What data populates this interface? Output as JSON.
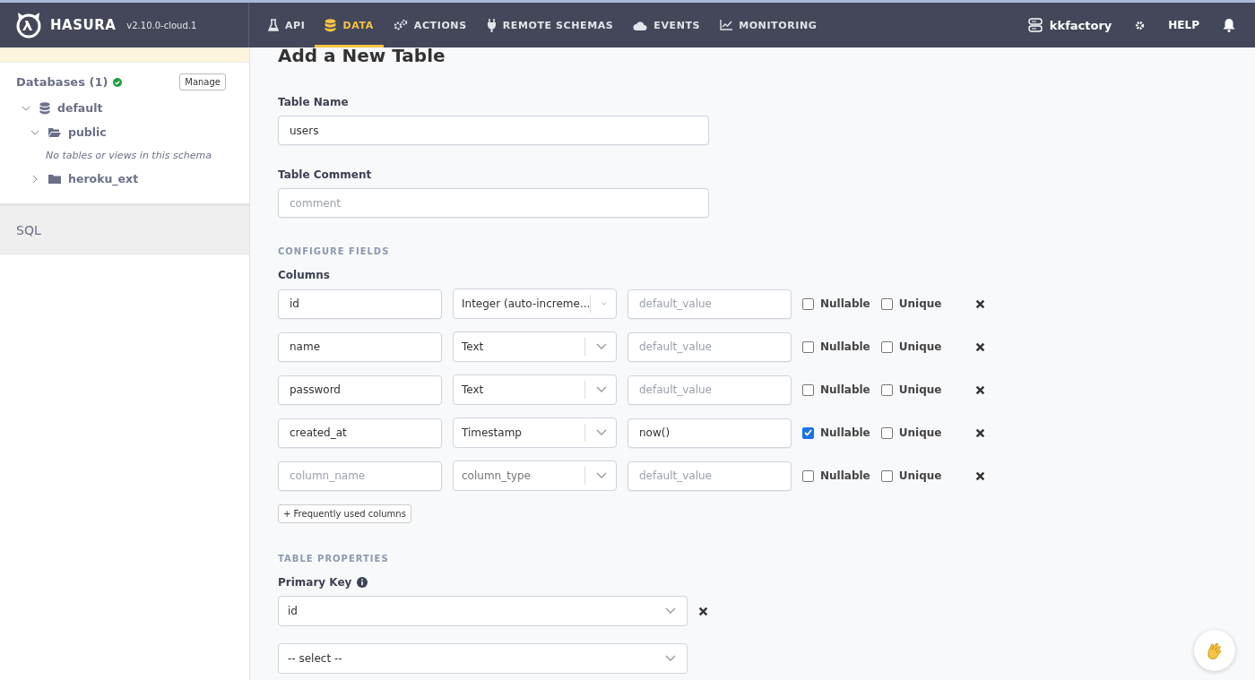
{
  "header": {
    "logo": "HASURA",
    "version": "v2.10.0-cloud.1",
    "nav": [
      {
        "label": "API",
        "kind": "flask",
        "selected": false
      },
      {
        "label": "DATA",
        "kind": "database",
        "selected": true
      },
      {
        "label": "ACTIONS",
        "kind": "gears",
        "selected": false
      },
      {
        "label": "REMOTE SCHEMAS",
        "kind": "plug",
        "selected": false
      },
      {
        "label": "EVENTS",
        "kind": "cloud",
        "selected": false
      },
      {
        "label": "MONITORING",
        "kind": "chart",
        "selected": false
      }
    ],
    "project": "kkfactory",
    "help": "HELP"
  },
  "sidebar": {
    "databases_label": "Databases (1)",
    "manage": "Manage",
    "tree": [
      {
        "label": "default",
        "kind": "database",
        "expanded": true,
        "children": [
          {
            "label": "public",
            "kind": "schema",
            "expanded": true,
            "empty_message": "No tables or views in this schema"
          },
          {
            "label": "heroku_ext",
            "kind": "schema",
            "expanded": false
          }
        ]
      }
    ],
    "sql": "SQL"
  },
  "form": {
    "title": "Add a New Table",
    "table_name_label": "Table Name",
    "table_name": "users",
    "comment_label": "Table Comment",
    "comment_placeholder": "comment",
    "configure_heading": "CONFIGURE FIELDS",
    "columns_label": "Columns",
    "columns": [
      {
        "name": "id",
        "type": "Integer (auto-increme...",
        "default_placeholder": "default_value",
        "nullable": false,
        "unique": false,
        "nullable_label": "Nullable",
        "unique_label": "Unique"
      },
      {
        "name": "name",
        "type": "Text",
        "default_placeholder": "default_value",
        "nullable": false,
        "unique": false,
        "nullable_label": "Nullable",
        "unique_label": "Unique"
      },
      {
        "name": "password",
        "type": "Text",
        "default_placeholder": "default_value",
        "nullable": false,
        "unique": false,
        "nullable_label": "Nullable",
        "unique_label": "Unique"
      },
      {
        "name": "created_at",
        "type": "Timestamp",
        "default": "now()",
        "nullable": true,
        "unique": false,
        "nullable_label": "Nullable",
        "unique_label": "Unique"
      },
      {
        "name_placeholder": "column_name",
        "type_placeholder": "column_type",
        "default_placeholder": "default_value",
        "nullable": false,
        "unique": false,
        "nullable_label": "Nullable",
        "unique_label": "Unique"
      }
    ],
    "frequent_button": "+ Frequently used columns",
    "properties_heading": "TABLE PROPERTIES",
    "primary_key_label": "Primary Key",
    "primary_keys": [
      {
        "value": "id"
      },
      {
        "placeholder": "-- select --"
      }
    ]
  }
}
